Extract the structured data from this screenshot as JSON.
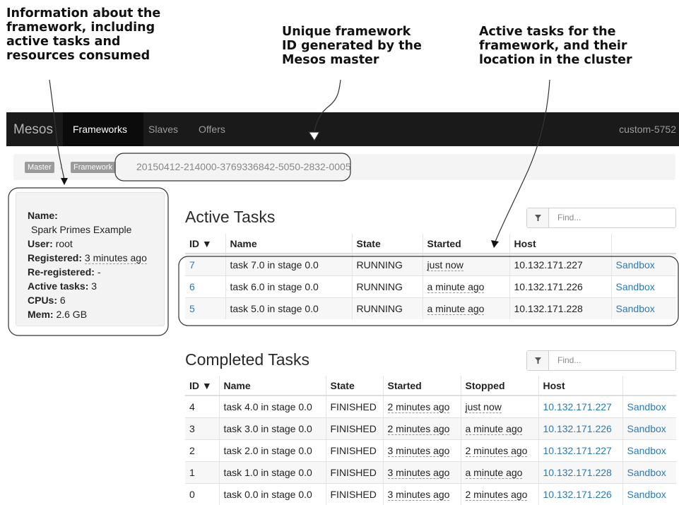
{
  "callouts": {
    "info": "Information about the\nframework, including\nactive tasks and\nresources consumed",
    "id": "Unique framework\nID generated by the\nMesos master",
    "tasks": "Active tasks for the\nframework, and their\nlocation in the cluster"
  },
  "navbar": {
    "brand": "Mesos",
    "items": [
      {
        "label": "Frameworks",
        "active": true
      },
      {
        "label": "Slaves",
        "active": false
      },
      {
        "label": "Offers",
        "active": false
      }
    ],
    "cluster": "custom-5752"
  },
  "breadcrumb": {
    "master": "Master",
    "framework": "Framework",
    "framework_id": "20150412-214000-3769336842-5050-2832-0005"
  },
  "info": {
    "name_label": "Name:",
    "name_value": "Spark Primes Example",
    "user_label": "User:",
    "user_value": "root",
    "registered_label": "Registered:",
    "registered_value": "3 minutes ago",
    "reregistered_label": "Re-registered:",
    "reregistered_value": "-",
    "active_label": "Active tasks:",
    "active_value": "3",
    "cpus_label": "CPUs:",
    "cpus_value": "6",
    "mem_label": "Mem:",
    "mem_value": "2.6 GB"
  },
  "active_tasks": {
    "title": "Active Tasks",
    "filter_placeholder": "Find...",
    "columns": [
      "ID ▼",
      "Name",
      "State",
      "Started",
      "Host",
      ""
    ],
    "rows": [
      {
        "id": "7",
        "name": "task 7.0 in stage 0.0",
        "state": "RUNNING",
        "started": "just now",
        "host": "10.132.171.227",
        "sandbox": "Sandbox"
      },
      {
        "id": "6",
        "name": "task 6.0 in stage 0.0",
        "state": "RUNNING",
        "started": "a minute ago",
        "host": "10.132.171.226",
        "sandbox": "Sandbox"
      },
      {
        "id": "5",
        "name": "task 5.0 in stage 0.0",
        "state": "RUNNING",
        "started": "a minute ago",
        "host": "10.132.171.228",
        "sandbox": "Sandbox"
      }
    ]
  },
  "completed_tasks": {
    "title": "Completed Tasks",
    "filter_placeholder": "Find...",
    "columns": [
      "ID ▼",
      "Name",
      "State",
      "Started",
      "Stopped",
      "Host",
      ""
    ],
    "rows": [
      {
        "id": "4",
        "name": "task 4.0 in stage 0.0",
        "state": "FINISHED",
        "started": "2 minutes ago",
        "stopped": "just now",
        "host": "10.132.171.227",
        "sandbox": "Sandbox"
      },
      {
        "id": "3",
        "name": "task 3.0 in stage 0.0",
        "state": "FINISHED",
        "started": "2 minutes ago",
        "stopped": "a minute ago",
        "host": "10.132.171.226",
        "sandbox": "Sandbox"
      },
      {
        "id": "2",
        "name": "task 2.0 in stage 0.0",
        "state": "FINISHED",
        "started": "3 minutes ago",
        "stopped": "2 minutes ago",
        "host": "10.132.171.227",
        "sandbox": "Sandbox"
      },
      {
        "id": "1",
        "name": "task 1.0 in stage 0.0",
        "state": "FINISHED",
        "started": "3 minutes ago",
        "stopped": "a minute ago",
        "host": "10.132.171.228",
        "sandbox": "Sandbox"
      },
      {
        "id": "0",
        "name": "task 0.0 in stage 0.0",
        "state": "FINISHED",
        "started": "3 minutes ago",
        "stopped": "2 minutes ago",
        "host": "10.132.171.226",
        "sandbox": "Sandbox"
      }
    ]
  },
  "icons": {
    "filter": "filter-icon",
    "sort": "sort-desc-icon"
  },
  "colors": {
    "navbar": "#1a1a1a",
    "link": "#2a7ab8",
    "panel": "#f3f3f3"
  }
}
